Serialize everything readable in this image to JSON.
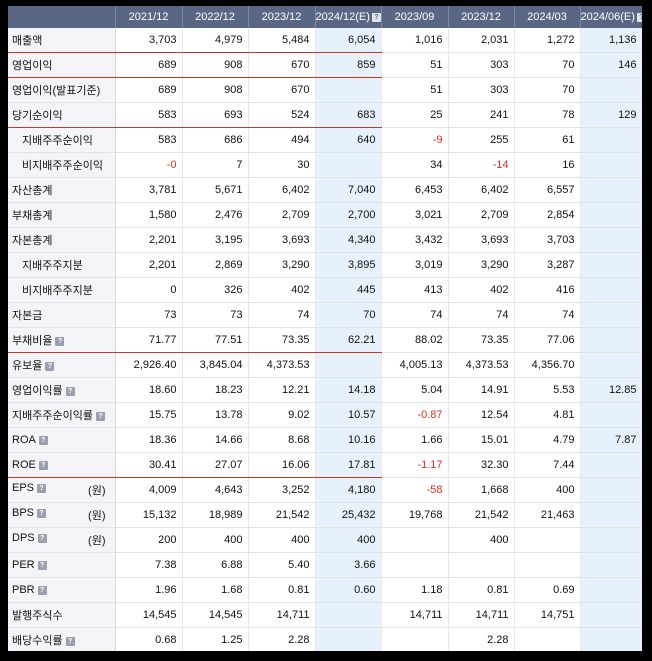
{
  "columns": [
    "2021/12",
    "2022/12",
    "2023/12",
    "2024/12(E)",
    "2023/09",
    "2023/12",
    "2024/03",
    "2024/06(E)"
  ],
  "estimate_columns": [
    3,
    7
  ],
  "colors": {
    "header_bg": "#5a6784",
    "estimate_bg": "#e6f1fb",
    "negative": "#e03020",
    "divider": "#c0392b"
  },
  "rows": [
    {
      "label": "매출액",
      "sub": false,
      "help": false,
      "unit": "",
      "divider": true,
      "values": [
        "3,703",
        "4,979",
        "5,484",
        "6,054",
        "1,016",
        "2,031",
        "1,272",
        "1,136"
      ]
    },
    {
      "label": "영업이익",
      "sub": false,
      "help": false,
      "unit": "",
      "divider": true,
      "values": [
        "689",
        "908",
        "670",
        "859",
        "51",
        "303",
        "70",
        "146"
      ]
    },
    {
      "label": "영업이익(발표기준)",
      "sub": false,
      "help": false,
      "unit": "",
      "divider": false,
      "values": [
        "689",
        "908",
        "670",
        "",
        "51",
        "303",
        "70",
        ""
      ]
    },
    {
      "label": "당기순이익",
      "sub": false,
      "help": false,
      "unit": "",
      "divider": true,
      "values": [
        "583",
        "693",
        "524",
        "683",
        "25",
        "241",
        "78",
        "129"
      ]
    },
    {
      "label": "지배주주순이익",
      "sub": true,
      "help": false,
      "unit": "",
      "divider": false,
      "values": [
        "583",
        "686",
        "494",
        "640",
        "-9",
        "255",
        "61",
        ""
      ]
    },
    {
      "label": "비지배주주순이익",
      "sub": true,
      "help": false,
      "unit": "",
      "divider": false,
      "values": [
        "-0",
        "7",
        "30",
        "",
        "34",
        "-14",
        "16",
        ""
      ]
    },
    {
      "label": "자산총계",
      "sub": false,
      "help": false,
      "unit": "",
      "divider": false,
      "values": [
        "3,781",
        "5,671",
        "6,402",
        "7,040",
        "6,453",
        "6,402",
        "6,557",
        ""
      ]
    },
    {
      "label": "부채총계",
      "sub": false,
      "help": false,
      "unit": "",
      "divider": false,
      "values": [
        "1,580",
        "2,476",
        "2,709",
        "2,700",
        "3,021",
        "2,709",
        "2,854",
        ""
      ]
    },
    {
      "label": "자본총계",
      "sub": false,
      "help": false,
      "unit": "",
      "divider": false,
      "values": [
        "2,201",
        "3,195",
        "3,693",
        "4,340",
        "3,432",
        "3,693",
        "3,703",
        ""
      ]
    },
    {
      "label": "지배주주지분",
      "sub": true,
      "help": false,
      "unit": "",
      "divider": false,
      "values": [
        "2,201",
        "2,869",
        "3,290",
        "3,895",
        "3,019",
        "3,290",
        "3,287",
        ""
      ]
    },
    {
      "label": "비지배주주지분",
      "sub": true,
      "help": false,
      "unit": "",
      "divider": false,
      "values": [
        "0",
        "326",
        "402",
        "445",
        "413",
        "402",
        "416",
        ""
      ]
    },
    {
      "label": "자본금",
      "sub": false,
      "help": false,
      "unit": "",
      "divider": false,
      "values": [
        "73",
        "73",
        "74",
        "70",
        "74",
        "74",
        "74",
        ""
      ]
    },
    {
      "label": "부채비율",
      "sub": false,
      "help": true,
      "unit": "",
      "divider": true,
      "values": [
        "71.77",
        "77.51",
        "73.35",
        "62.21",
        "88.02",
        "73.35",
        "77.06",
        ""
      ]
    },
    {
      "label": "유보율",
      "sub": false,
      "help": true,
      "unit": "",
      "divider": false,
      "values": [
        "2,926.40",
        "3,845.04",
        "4,373.53",
        "",
        "4,005.13",
        "4,373.53",
        "4,356.70",
        ""
      ]
    },
    {
      "label": "영업이익률",
      "sub": false,
      "help": true,
      "unit": "",
      "divider": false,
      "values": [
        "18.60",
        "18.23",
        "12.21",
        "14.18",
        "5.04",
        "14.91",
        "5.53",
        "12.85"
      ]
    },
    {
      "label": "지배주주순이익률",
      "sub": false,
      "help": true,
      "unit": "",
      "divider": false,
      "values": [
        "15.75",
        "13.78",
        "9.02",
        "10.57",
        "-0.87",
        "12.54",
        "4.81",
        ""
      ]
    },
    {
      "label": "ROA",
      "sub": false,
      "help": true,
      "unit": "",
      "divider": false,
      "values": [
        "18.36",
        "14.66",
        "8.68",
        "10.16",
        "1.66",
        "15.01",
        "4.79",
        "7.87"
      ]
    },
    {
      "label": "ROE",
      "sub": false,
      "help": true,
      "unit": "",
      "divider": true,
      "values": [
        "30.41",
        "27.07",
        "16.06",
        "17.81",
        "-1.17",
        "32.30",
        "7.44",
        ""
      ]
    },
    {
      "label": "EPS",
      "sub": false,
      "help": true,
      "unit": "(원)",
      "divider": false,
      "values": [
        "4,009",
        "4,643",
        "3,252",
        "4,180",
        "-58",
        "1,668",
        "400",
        ""
      ]
    },
    {
      "label": "BPS",
      "sub": false,
      "help": true,
      "unit": "(원)",
      "divider": false,
      "values": [
        "15,132",
        "18,989",
        "21,542",
        "25,432",
        "19,768",
        "21,542",
        "21,463",
        ""
      ]
    },
    {
      "label": "DPS",
      "sub": false,
      "help": true,
      "unit": "(원)",
      "divider": false,
      "values": [
        "200",
        "400",
        "400",
        "400",
        "",
        "400",
        "",
        ""
      ]
    },
    {
      "label": "PER",
      "sub": false,
      "help": true,
      "unit": "",
      "divider": false,
      "values": [
        "7.38",
        "6.88",
        "5.40",
        "3.66",
        "",
        "",
        "",
        ""
      ]
    },
    {
      "label": "PBR",
      "sub": false,
      "help": true,
      "unit": "",
      "divider": false,
      "values": [
        "1.96",
        "1.68",
        "0.81",
        "0.60",
        "1.18",
        "0.81",
        "0.69",
        ""
      ]
    },
    {
      "label": "발행주식수",
      "sub": false,
      "help": false,
      "unit": "",
      "divider": false,
      "values": [
        "14,545",
        "14,545",
        "14,711",
        "",
        "14,711",
        "14,711",
        "14,751",
        ""
      ]
    },
    {
      "label": "배당수익률",
      "sub": false,
      "help": true,
      "unit": "",
      "divider": false,
      "values": [
        "0.68",
        "1.25",
        "2.28",
        "",
        "",
        "2.28",
        "",
        ""
      ]
    }
  ]
}
